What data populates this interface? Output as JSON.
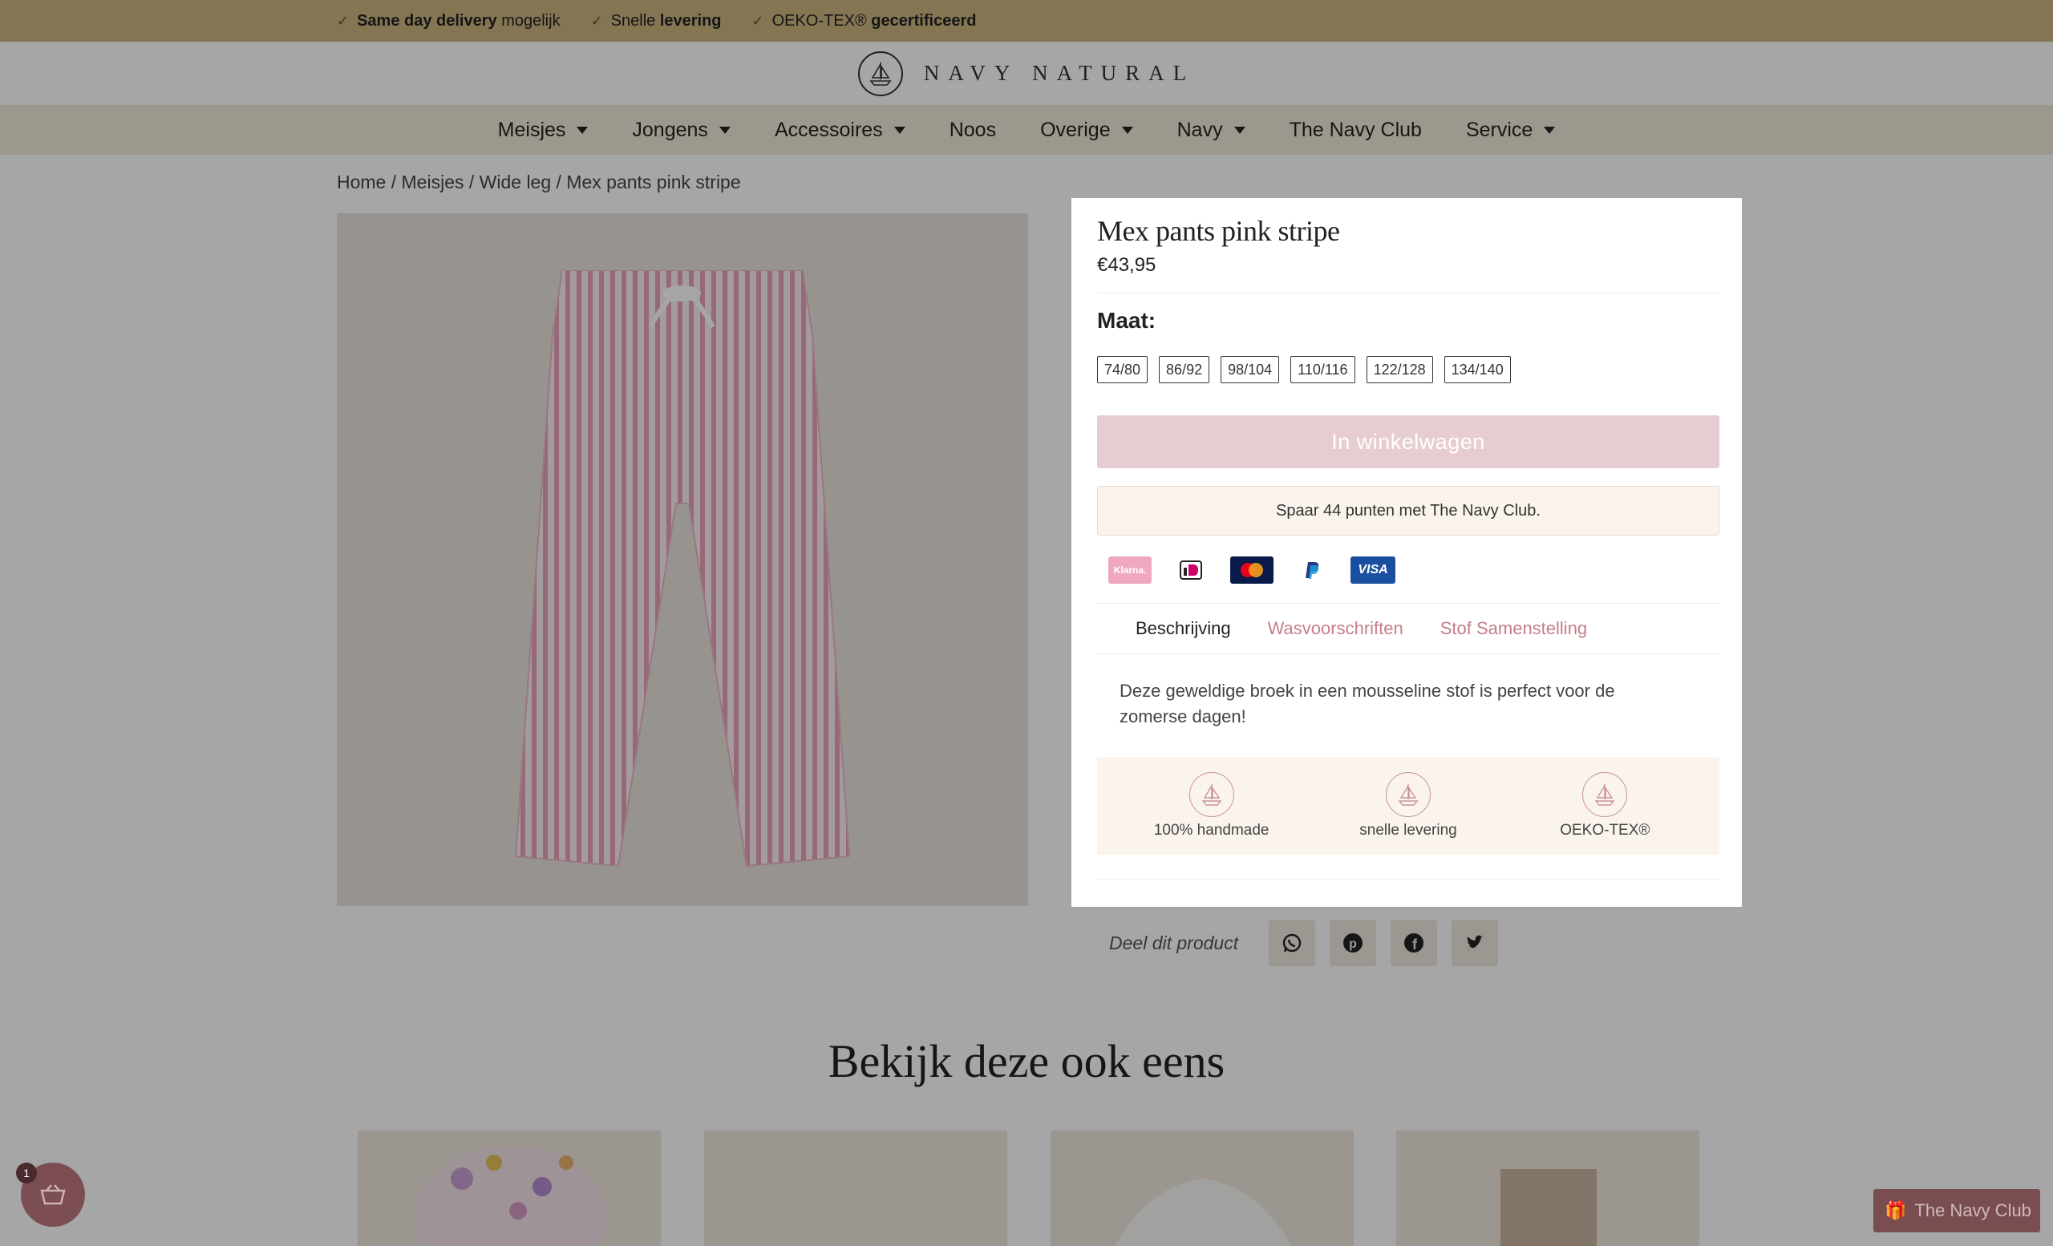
{
  "topbar": {
    "items": [
      {
        "bold": "Same day delivery",
        "rest": " mogelijk"
      },
      {
        "pre": "Snelle ",
        "bold": "levering"
      },
      {
        "pre": "OEKO-TEX® ",
        "bold": "gecertificeerd"
      }
    ]
  },
  "header": {
    "logo_text": "NAVY NATURAL"
  },
  "nav": {
    "items": [
      {
        "label": "Meisjes"
      },
      {
        "label": "Jongens"
      },
      {
        "label": "Accessoires"
      },
      {
        "label": "Noos"
      },
      {
        "label": "Overige"
      },
      {
        "label": "Navy"
      },
      {
        "label": "The Navy Club"
      },
      {
        "label": "Service"
      }
    ]
  },
  "breadcrumb": "Home / Meisjes / Wide leg / Mex pants pink stripe",
  "share": {
    "label": "Deel dit product"
  },
  "related": {
    "title": "Bekijk deze ook eens"
  },
  "cart": {
    "count": "1"
  },
  "navy_club_button": "The Navy Club",
  "modal": {
    "title": "Mex pants pink stripe",
    "price": "€43,95",
    "size_label": "Maat:",
    "sizes": [
      "74/80",
      "86/92",
      "98/104",
      "110/116",
      "122/128",
      "134/140"
    ],
    "add_to_cart": "In winkelwagen",
    "points": "Spaar 44 punten met The Navy Club.",
    "payments": [
      "Klarna.",
      "iDEAL",
      "Mastercard",
      "PayPal",
      "VISA"
    ],
    "tabs": [
      "Beschrijving",
      "Wasvoorschriften",
      "Stof Samenstelling"
    ],
    "description": "Deze geweldige broek in een mousseline stof is perfect voor de zomerse dagen!",
    "usps": [
      "100% handmade",
      "snelle levering",
      "OEKO-TEX®"
    ]
  },
  "colors": {
    "accent": "#c57e87",
    "topbar": "#cbb480",
    "nav": "#f1ead9",
    "cart_button": "#e7cdd1"
  }
}
